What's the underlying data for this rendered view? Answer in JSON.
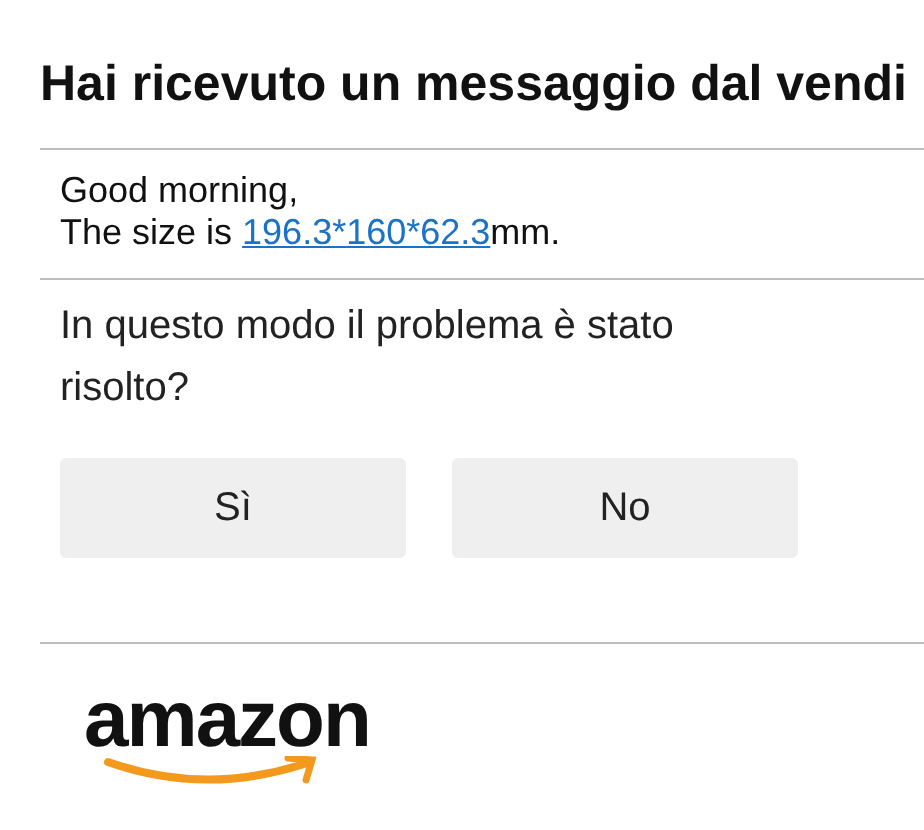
{
  "title": "Hai ricevuto un messaggio dal vendi",
  "message": {
    "greeting": "Good morning,",
    "size_prefix": "The size is ",
    "size_link": "196.3*160*62.3",
    "size_suffix": "mm."
  },
  "question": "In questo modo il problema è stato risolto?",
  "buttons": [
    "Sì",
    "No"
  ],
  "logo": "amazon"
}
